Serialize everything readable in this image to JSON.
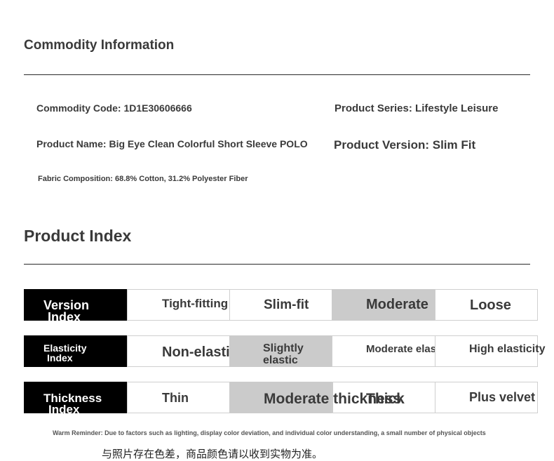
{
  "commodity": {
    "heading": "Commodity Information",
    "code": "Commodity Code: 1D1E30606666",
    "series": "Product Series: Lifestyle Leisure",
    "name": "Product Name: Big Eye Clean Colorful Short Sleeve POLO",
    "version": "Product Version: Slim Fit",
    "fabric": "Fabric Composition: 68.8% Cotton, 31.2% Polyester Fiber"
  },
  "index": {
    "heading": "Product Index",
    "rows": [
      {
        "label_line1": "Version",
        "label_line2": "Index",
        "options": [
          "Tight-fitting",
          "Slim-fit",
          "Moderate",
          "Loose"
        ],
        "selected": 2
      },
      {
        "label_line1": "Elasticity",
        "label_line2": "Index",
        "options": [
          "Non-elastic",
          "Slightly elastic",
          "Moderate elasticity",
          "High elasticity"
        ],
        "selected": 1
      },
      {
        "label_line1": "Thickness",
        "label_line2": "Index",
        "options": [
          "Thin",
          "Moderate thickness",
          "Thick",
          "Plus velvet"
        ],
        "selected": 1
      }
    ]
  },
  "footer": {
    "notice": "Warm Reminder: Due to factors such as lighting, display color deviation, and individual color understanding, a small number of physical objects",
    "cn_line": "与照片存在色差，商品颜色请以收到实物为准。"
  },
  "colors": {
    "label_bg": "#000000",
    "selected_bg": "#cbcbcb",
    "text": "#3a3a3a"
  }
}
